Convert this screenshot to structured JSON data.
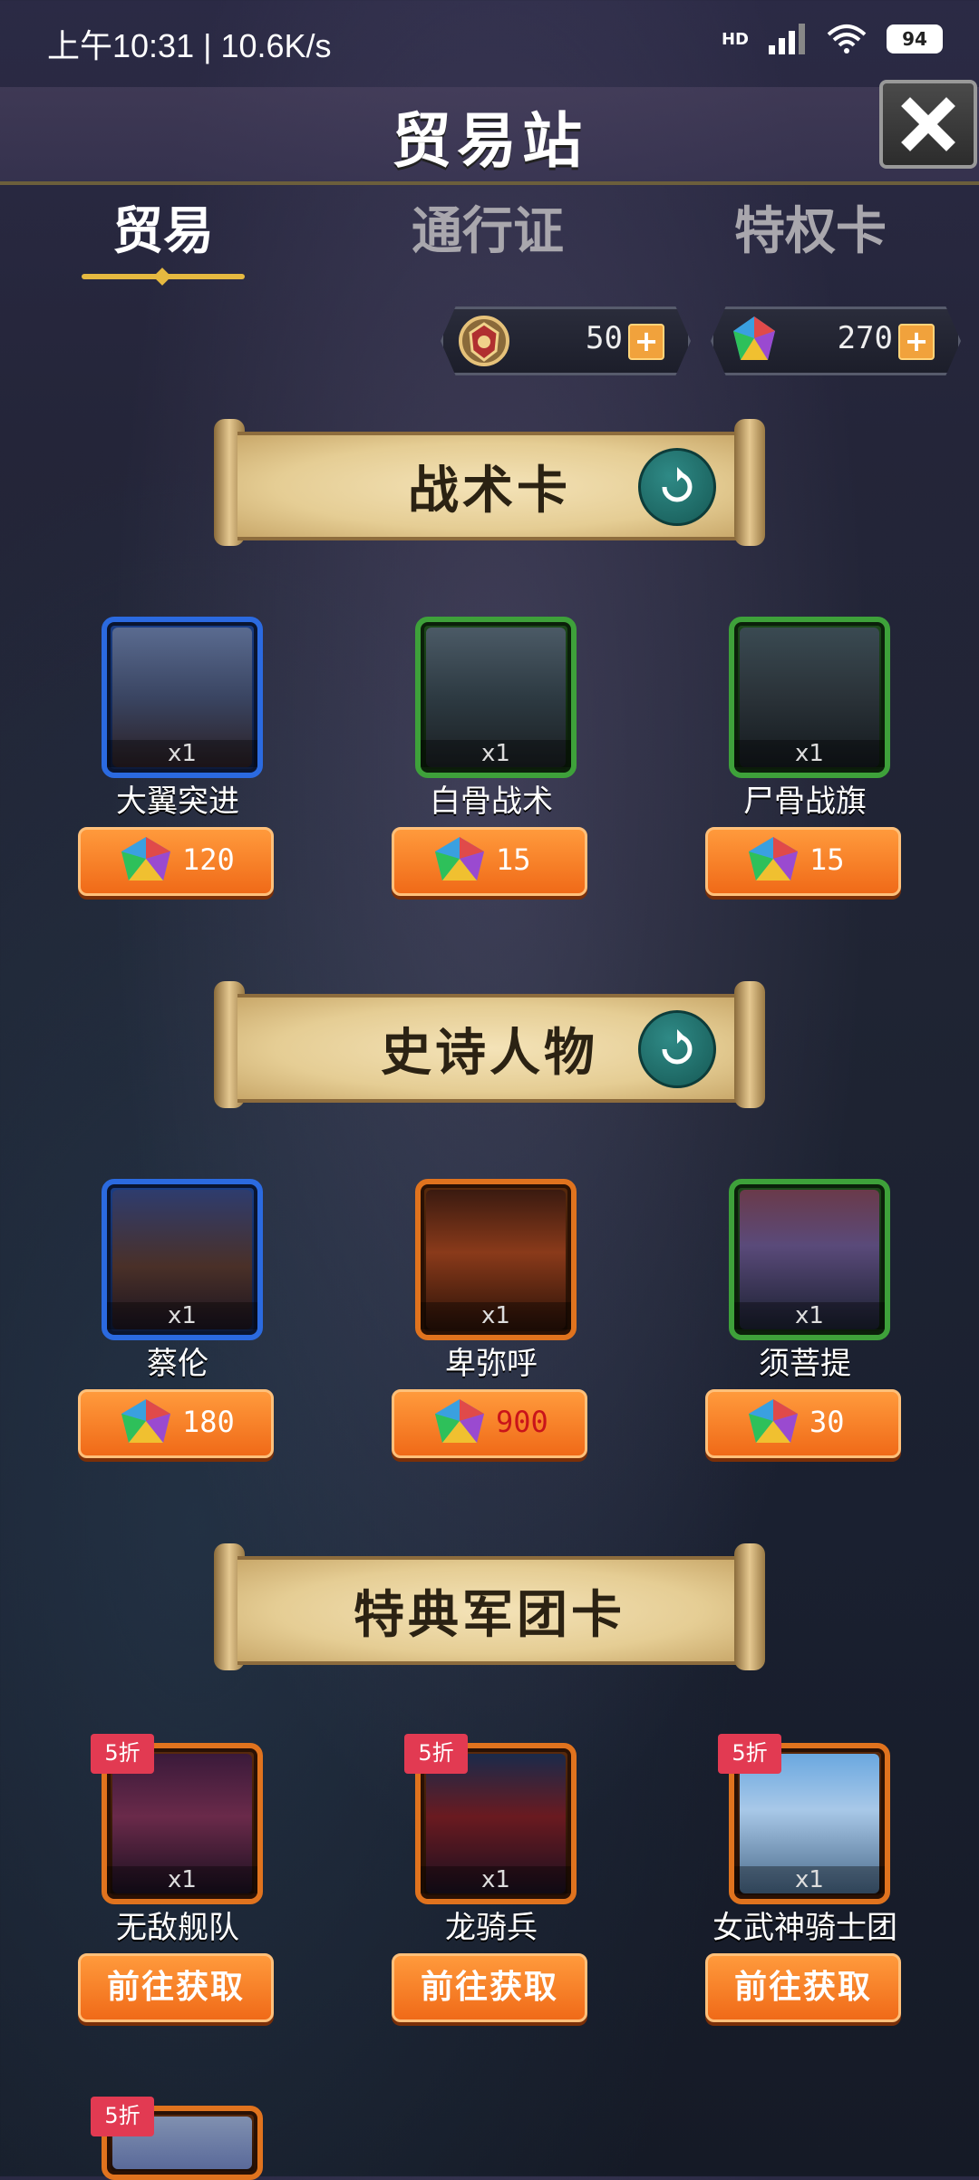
{
  "status": {
    "time_speed": "上午10:31 | 10.6K/s",
    "network": "HD",
    "battery": "94"
  },
  "header": {
    "title": "贸易站"
  },
  "tabs": [
    {
      "label": "贸易",
      "active": true
    },
    {
      "label": "通行证",
      "active": false
    },
    {
      "label": "特权卡",
      "active": false
    }
  ],
  "currency": {
    "emblem": {
      "icon": "emblem-icon",
      "amount": "50"
    },
    "gem": {
      "icon": "gem-icon",
      "amount": "270"
    }
  },
  "sections": {
    "tactics": {
      "title": "战术卡",
      "items": [
        {
          "name": "大翼突进",
          "qty": "x1",
          "price": "120",
          "rarity": "blue"
        },
        {
          "name": "白骨战术",
          "qty": "x1",
          "price": "15",
          "rarity": "green"
        },
        {
          "name": "尸骨战旗",
          "qty": "x1",
          "price": "15",
          "rarity": "green"
        }
      ]
    },
    "heroes": {
      "title": "史诗人物",
      "items": [
        {
          "name": "蔡伦",
          "qty": "x1",
          "price": "180",
          "rarity": "blue"
        },
        {
          "name": "卑弥呼",
          "qty": "x1",
          "price": "900",
          "rarity": "orange",
          "price_color": "#c9141a"
        },
        {
          "name": "须菩提",
          "qty": "x1",
          "price": "30",
          "rarity": "green"
        }
      ]
    },
    "legion": {
      "title": "特典军团卡",
      "items": [
        {
          "name": "无敌舰队",
          "qty": "x1",
          "badge": "5折",
          "action": "前往获取"
        },
        {
          "name": "龙骑兵",
          "qty": "x1",
          "badge": "5折",
          "action": "前往获取"
        },
        {
          "name": "女武神骑士团",
          "qty": "x1",
          "badge": "5折",
          "action": "前往获取"
        }
      ],
      "partial_badge": "5折"
    }
  },
  "colors": {
    "accent": "#e6b940",
    "button": "#f07a22",
    "badge": "#e23a52",
    "refresh": "#1f6e6a"
  }
}
